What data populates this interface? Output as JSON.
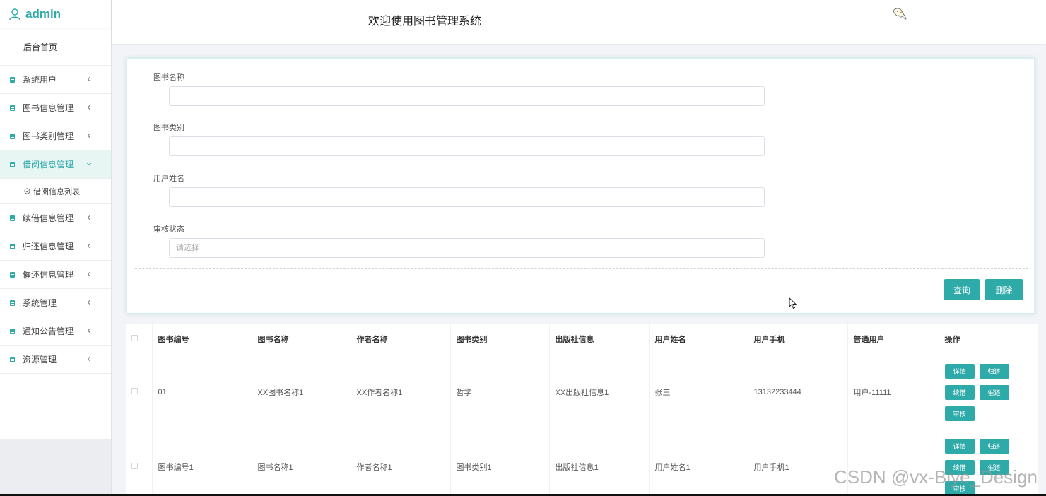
{
  "brand": {
    "name": "admin"
  },
  "sidebar": {
    "home": "后台首页",
    "items": [
      {
        "label": "系统用户",
        "active": false
      },
      {
        "label": "图书信息管理",
        "active": false
      },
      {
        "label": "图书类别管理",
        "active": false
      },
      {
        "label": "借阅信息管理",
        "active": true
      },
      {
        "label": "续借信息管理",
        "active": false
      },
      {
        "label": "归还信息管理",
        "active": false
      },
      {
        "label": "催还信息管理",
        "active": false
      },
      {
        "label": "系统管理",
        "active": false
      },
      {
        "label": "通知公告管理",
        "active": false
      },
      {
        "label": "资源管理",
        "active": false
      }
    ],
    "sub_item": "借阅信息列表"
  },
  "header": {
    "title": "欢迎使用图书管理系统"
  },
  "search": {
    "fields": [
      {
        "label": "图书名称",
        "value": "",
        "placeholder": ""
      },
      {
        "label": "图书类别",
        "value": "",
        "placeholder": ""
      },
      {
        "label": "用户姓名",
        "value": "",
        "placeholder": ""
      },
      {
        "label": "审核状态",
        "value": "",
        "placeholder": "请选择"
      }
    ],
    "query_label": "查询",
    "delete_label": "删除"
  },
  "table": {
    "columns": [
      "图书编号",
      "图书名称",
      "作者名称",
      "图书类别",
      "出版社信息",
      "用户姓名",
      "用户手机",
      "普通用户",
      "操作"
    ],
    "rows": [
      [
        "01",
        "XX图书名称1",
        "XX作者名称1",
        "哲学",
        "XX出版社信息1",
        "张三",
        "13132233444",
        "用户-11111"
      ],
      [
        "图书编号1",
        "图书名称1",
        "作者名称1",
        "图书类别1",
        "出版社信息1",
        "用户姓名1",
        "用户手机1",
        ""
      ]
    ],
    "row_actions": [
      "详情",
      "归还",
      "续借",
      "催还",
      "审核"
    ]
  },
  "watermark": "CSDN @vx-Biye_Design",
  "colors": {
    "accent": "#2eaaa9",
    "active_bg": "#e7f5f3"
  }
}
